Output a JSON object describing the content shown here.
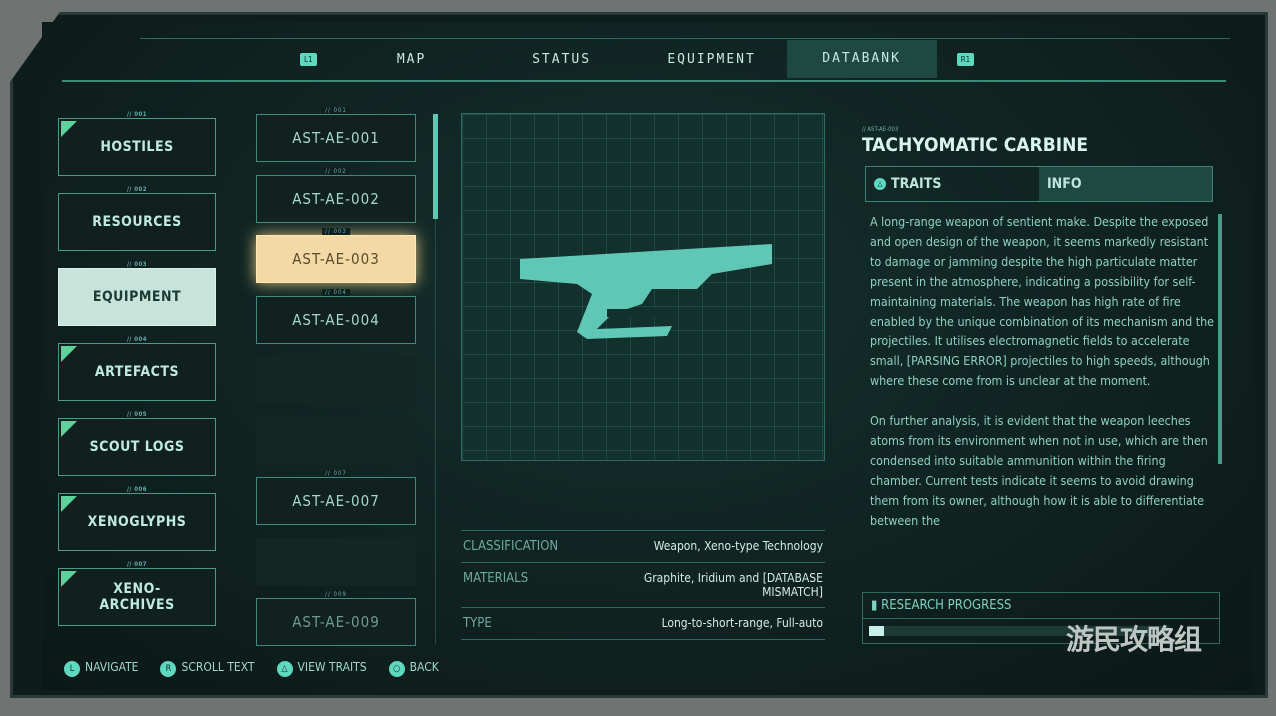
{
  "nav": {
    "left_key": "L1",
    "right_key": "R1",
    "tabs": [
      {
        "label": "MAP"
      },
      {
        "label": "STATUS"
      },
      {
        "label": "EQUIPMENT"
      },
      {
        "label": "DATABANK",
        "active": true
      }
    ]
  },
  "categories": [
    {
      "num": "// 001",
      "label": "HOSTILES",
      "new": true
    },
    {
      "num": "// 002",
      "label": "RESOURCES",
      "new": false
    },
    {
      "num": "// 003",
      "label": "EQUIPMENT",
      "selected": true
    },
    {
      "num": "// 004",
      "label": "ARTEFACTS",
      "new": true
    },
    {
      "num": "// 005",
      "label": "SCOUT LOGS",
      "new": true
    },
    {
      "num": "// 006",
      "label": "XENOGLYPHS",
      "new": true
    },
    {
      "num": "// 007",
      "label": "XENO-ARCHIVES",
      "new": true
    }
  ],
  "entries": [
    {
      "num": "// 001",
      "label": "AST-AE-001"
    },
    {
      "num": "// 002",
      "label": "AST-AE-002"
    },
    {
      "num": "// 003",
      "label": "AST-AE-003",
      "selected": true
    },
    {
      "num": "// 004",
      "label": "AST-AE-004"
    },
    {
      "num": "",
      "label": ""
    },
    {
      "num": "",
      "label": ""
    },
    {
      "num": "// 007",
      "label": "AST-AE-007"
    },
    {
      "num": "",
      "label": ""
    },
    {
      "num": "// 009",
      "label": "AST-AE-009"
    }
  ],
  "specs": [
    {
      "key": "CLASSIFICATION",
      "value": "Weapon, Xeno-type Technology"
    },
    {
      "key": "MATERIALS",
      "value": "Graphite, Iridium and [DATABASE MISMATCH]"
    },
    {
      "key": "TYPE",
      "value": "Long-to-short-range, Full-auto"
    }
  ],
  "detail": {
    "id": "// AST-AE-003",
    "title": "TACHYOMATIC CARBINE",
    "tabs": {
      "traits": "TRAITS",
      "info": "INFO",
      "traits_key": "△"
    },
    "paragraphs": [
      "A long-range weapon of sentient make. Despite the exposed and open design of the weapon, it seems markedly resistant to damage or jamming despite the high particulate matter present in the atmosphere, indicating a possibility for self-maintaining materials. The weapon has high rate of fire enabled by the unique combination of its mechanism and the projectiles. It utilises electromagnetic fields to accelerate small, [PARSING ERROR] projectiles to high speeds, although where these come from is unclear at the moment.",
      "On further analysis, it is evident that the weapon leeches atoms from its environment when not in use, which are then condensed into suitable ammunition within the firing chamber. Current tests indicate it seems to avoid drawing them from its owner, although how it is able to differentiate between the"
    ],
    "research_label": "RESEARCH PROGRESS",
    "research_progress_percent": 5
  },
  "footer": [
    {
      "key": "L",
      "label": "NAVIGATE"
    },
    {
      "key": "R",
      "label": "SCROLL TEXT"
    },
    {
      "key": "△",
      "label": "VIEW TRAITS"
    },
    {
      "key": "○",
      "label": "BACK"
    }
  ],
  "watermark": "游民攻略组",
  "colors": {
    "accent": "#5fd8c0",
    "selected_entry": "#f2d9a5",
    "selected_category": "#c7e3da"
  }
}
